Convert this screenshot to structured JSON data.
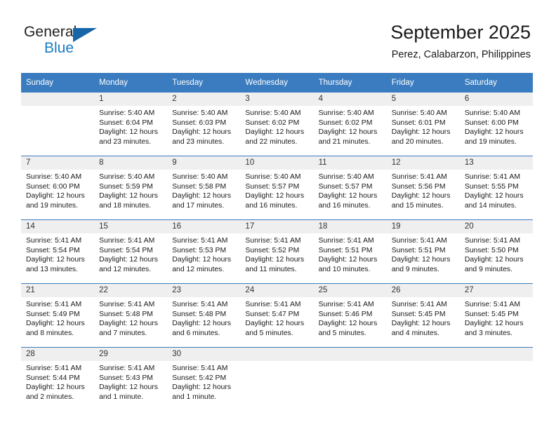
{
  "logo": {
    "word_top": "General",
    "word_bottom": "Blue",
    "triangle_color": "#1565a8",
    "blue_color": "#1a7dc4"
  },
  "header": {
    "month_title": "September 2025",
    "location": "Perez, Calabarzon, Philippines"
  },
  "theme": {
    "header_blue": "#3a7cbf",
    "daynum_band": "#efefef",
    "text": "#1a1a1a"
  },
  "weekdays": [
    "Sunday",
    "Monday",
    "Tuesday",
    "Wednesday",
    "Thursday",
    "Friday",
    "Saturday"
  ],
  "labels": {
    "sunrise_prefix": "Sunrise:",
    "sunset_prefix": "Sunset:",
    "daylight_prefix": "Daylight:"
  },
  "weeks": [
    [
      {
        "day": "",
        "empty": true,
        "line1": "",
        "line2": "",
        "line3": "",
        "line4": ""
      },
      {
        "day": "1",
        "empty": false,
        "line1": "Sunrise: 5:40 AM",
        "line2": "Sunset: 6:04 PM",
        "line3": "Daylight: 12 hours",
        "line4": "and 23 minutes."
      },
      {
        "day": "2",
        "empty": false,
        "line1": "Sunrise: 5:40 AM",
        "line2": "Sunset: 6:03 PM",
        "line3": "Daylight: 12 hours",
        "line4": "and 23 minutes."
      },
      {
        "day": "3",
        "empty": false,
        "line1": "Sunrise: 5:40 AM",
        "line2": "Sunset: 6:02 PM",
        "line3": "Daylight: 12 hours",
        "line4": "and 22 minutes."
      },
      {
        "day": "4",
        "empty": false,
        "line1": "Sunrise: 5:40 AM",
        "line2": "Sunset: 6:02 PM",
        "line3": "Daylight: 12 hours",
        "line4": "and 21 minutes."
      },
      {
        "day": "5",
        "empty": false,
        "line1": "Sunrise: 5:40 AM",
        "line2": "Sunset: 6:01 PM",
        "line3": "Daylight: 12 hours",
        "line4": "and 20 minutes."
      },
      {
        "day": "6",
        "empty": false,
        "line1": "Sunrise: 5:40 AM",
        "line2": "Sunset: 6:00 PM",
        "line3": "Daylight: 12 hours",
        "line4": "and 19 minutes."
      }
    ],
    [
      {
        "day": "7",
        "empty": false,
        "line1": "Sunrise: 5:40 AM",
        "line2": "Sunset: 6:00 PM",
        "line3": "Daylight: 12 hours",
        "line4": "and 19 minutes."
      },
      {
        "day": "8",
        "empty": false,
        "line1": "Sunrise: 5:40 AM",
        "line2": "Sunset: 5:59 PM",
        "line3": "Daylight: 12 hours",
        "line4": "and 18 minutes."
      },
      {
        "day": "9",
        "empty": false,
        "line1": "Sunrise: 5:40 AM",
        "line2": "Sunset: 5:58 PM",
        "line3": "Daylight: 12 hours",
        "line4": "and 17 minutes."
      },
      {
        "day": "10",
        "empty": false,
        "line1": "Sunrise: 5:40 AM",
        "line2": "Sunset: 5:57 PM",
        "line3": "Daylight: 12 hours",
        "line4": "and 16 minutes."
      },
      {
        "day": "11",
        "empty": false,
        "line1": "Sunrise: 5:40 AM",
        "line2": "Sunset: 5:57 PM",
        "line3": "Daylight: 12 hours",
        "line4": "and 16 minutes."
      },
      {
        "day": "12",
        "empty": false,
        "line1": "Sunrise: 5:41 AM",
        "line2": "Sunset: 5:56 PM",
        "line3": "Daylight: 12 hours",
        "line4": "and 15 minutes."
      },
      {
        "day": "13",
        "empty": false,
        "line1": "Sunrise: 5:41 AM",
        "line2": "Sunset: 5:55 PM",
        "line3": "Daylight: 12 hours",
        "line4": "and 14 minutes."
      }
    ],
    [
      {
        "day": "14",
        "empty": false,
        "line1": "Sunrise: 5:41 AM",
        "line2": "Sunset: 5:54 PM",
        "line3": "Daylight: 12 hours",
        "line4": "and 13 minutes."
      },
      {
        "day": "15",
        "empty": false,
        "line1": "Sunrise: 5:41 AM",
        "line2": "Sunset: 5:54 PM",
        "line3": "Daylight: 12 hours",
        "line4": "and 12 minutes."
      },
      {
        "day": "16",
        "empty": false,
        "line1": "Sunrise: 5:41 AM",
        "line2": "Sunset: 5:53 PM",
        "line3": "Daylight: 12 hours",
        "line4": "and 12 minutes."
      },
      {
        "day": "17",
        "empty": false,
        "line1": "Sunrise: 5:41 AM",
        "line2": "Sunset: 5:52 PM",
        "line3": "Daylight: 12 hours",
        "line4": "and 11 minutes."
      },
      {
        "day": "18",
        "empty": false,
        "line1": "Sunrise: 5:41 AM",
        "line2": "Sunset: 5:51 PM",
        "line3": "Daylight: 12 hours",
        "line4": "and 10 minutes."
      },
      {
        "day": "19",
        "empty": false,
        "line1": "Sunrise: 5:41 AM",
        "line2": "Sunset: 5:51 PM",
        "line3": "Daylight: 12 hours",
        "line4": "and 9 minutes."
      },
      {
        "day": "20",
        "empty": false,
        "line1": "Sunrise: 5:41 AM",
        "line2": "Sunset: 5:50 PM",
        "line3": "Daylight: 12 hours",
        "line4": "and 9 minutes."
      }
    ],
    [
      {
        "day": "21",
        "empty": false,
        "line1": "Sunrise: 5:41 AM",
        "line2": "Sunset: 5:49 PM",
        "line3": "Daylight: 12 hours",
        "line4": "and 8 minutes."
      },
      {
        "day": "22",
        "empty": false,
        "line1": "Sunrise: 5:41 AM",
        "line2": "Sunset: 5:48 PM",
        "line3": "Daylight: 12 hours",
        "line4": "and 7 minutes."
      },
      {
        "day": "23",
        "empty": false,
        "line1": "Sunrise: 5:41 AM",
        "line2": "Sunset: 5:48 PM",
        "line3": "Daylight: 12 hours",
        "line4": "and 6 minutes."
      },
      {
        "day": "24",
        "empty": false,
        "line1": "Sunrise: 5:41 AM",
        "line2": "Sunset: 5:47 PM",
        "line3": "Daylight: 12 hours",
        "line4": "and 5 minutes."
      },
      {
        "day": "25",
        "empty": false,
        "line1": "Sunrise: 5:41 AM",
        "line2": "Sunset: 5:46 PM",
        "line3": "Daylight: 12 hours",
        "line4": "and 5 minutes."
      },
      {
        "day": "26",
        "empty": false,
        "line1": "Sunrise: 5:41 AM",
        "line2": "Sunset: 5:45 PM",
        "line3": "Daylight: 12 hours",
        "line4": "and 4 minutes."
      },
      {
        "day": "27",
        "empty": false,
        "line1": "Sunrise: 5:41 AM",
        "line2": "Sunset: 5:45 PM",
        "line3": "Daylight: 12 hours",
        "line4": "and 3 minutes."
      }
    ],
    [
      {
        "day": "28",
        "empty": false,
        "line1": "Sunrise: 5:41 AM",
        "line2": "Sunset: 5:44 PM",
        "line3": "Daylight: 12 hours",
        "line4": "and 2 minutes."
      },
      {
        "day": "29",
        "empty": false,
        "line1": "Sunrise: 5:41 AM",
        "line2": "Sunset: 5:43 PM",
        "line3": "Daylight: 12 hours",
        "line4": "and 1 minute."
      },
      {
        "day": "30",
        "empty": false,
        "line1": "Sunrise: 5:41 AM",
        "line2": "Sunset: 5:42 PM",
        "line3": "Daylight: 12 hours",
        "line4": "and 1 minute."
      },
      {
        "day": "",
        "empty": true,
        "line1": "",
        "line2": "",
        "line3": "",
        "line4": ""
      },
      {
        "day": "",
        "empty": true,
        "line1": "",
        "line2": "",
        "line3": "",
        "line4": ""
      },
      {
        "day": "",
        "empty": true,
        "line1": "",
        "line2": "",
        "line3": "",
        "line4": ""
      },
      {
        "day": "",
        "empty": true,
        "line1": "",
        "line2": "",
        "line3": "",
        "line4": ""
      }
    ]
  ]
}
